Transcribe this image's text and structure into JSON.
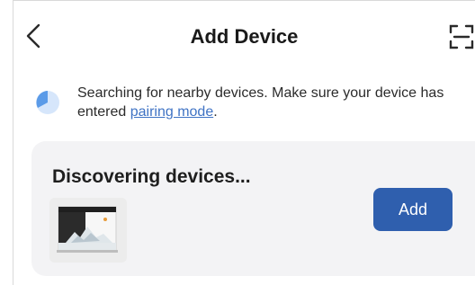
{
  "header": {
    "title": "Add Device",
    "back_icon": "chevron-left-icon",
    "scan_icon": "scan-frame-icon"
  },
  "hint": {
    "icon": "searching-radar-icon",
    "text_before_link": "Searching for nearby devices. Make sure your device has entered ",
    "link_text": "pairing mode",
    "text_after_link": "."
  },
  "discovery": {
    "title": "Discovering devices...",
    "add_label": "Add",
    "device_image": "aquarium-device-thumbnail"
  },
  "colors": {
    "accent": "#2f5fae",
    "link": "#3f73c4",
    "card_background": "#f3f3f5"
  }
}
